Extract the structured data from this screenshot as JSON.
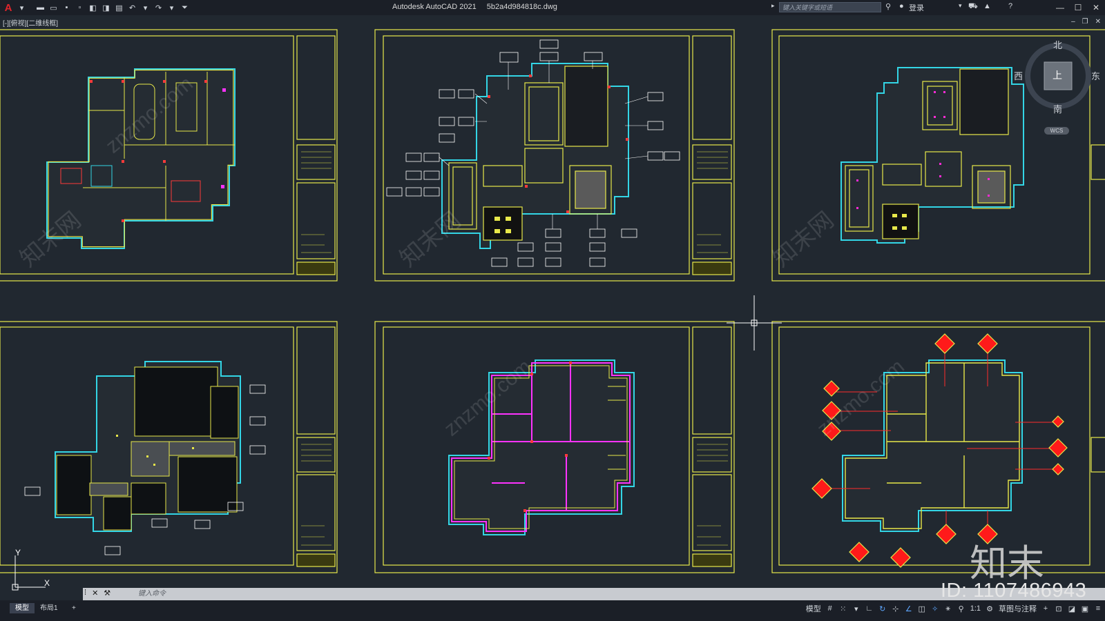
{
  "app": {
    "title": "Autodesk AutoCAD 2021",
    "filename": "5b2a4d984818c.dwg",
    "logo_letter": "A"
  },
  "search": {
    "placeholder": "键入关键字或短语"
  },
  "user": {
    "login_label": "登录"
  },
  "viewport": {
    "label": "[-][俯视][二维线框]"
  },
  "viewcube": {
    "north": "北",
    "south": "南",
    "west": "西",
    "east": "东",
    "face": "上",
    "wcs": "WCS"
  },
  "command": {
    "placeholder": "键入命令"
  },
  "tabs": [
    {
      "label": "模型"
    },
    {
      "label": "布局1"
    },
    {
      "label": "+"
    }
  ],
  "status": {
    "model_label": "模型",
    "scale": "1:1",
    "workspace": "草图与注释"
  },
  "watermark": {
    "site": "znzmo.com",
    "brand_cn": "知末网",
    "logo_text": "知末",
    "id_text": "ID: 1107486943"
  },
  "ucs": {
    "y_label": "Y",
    "x_label": "X"
  },
  "colors": {
    "canvas_bg": "#212830",
    "frame": "#ffff00",
    "wall": "#00ffff",
    "red": "#ff2b2b",
    "magenta": "#ff33ff",
    "white": "#ffffff"
  }
}
